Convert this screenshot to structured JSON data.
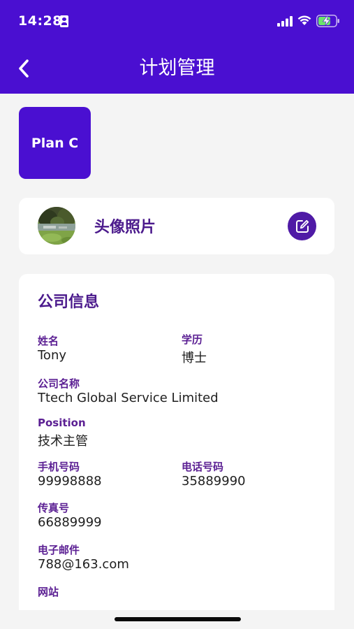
{
  "status_bar": {
    "time": "14:28",
    "icons": [
      "id-card-icon",
      "cellular-signal-icon",
      "wifi-icon",
      "battery-charging-icon"
    ]
  },
  "header": {
    "title": "计划管理",
    "back_icon": "chevron-left-icon",
    "background_color": "#4a0fd1"
  },
  "plan": {
    "label": "Plan C"
  },
  "avatar_section": {
    "label": "头像照片",
    "edit_icon": "edit-icon"
  },
  "company_info": {
    "title": "公司信息",
    "fields": {
      "name": {
        "label": "姓名",
        "value": "Tony"
      },
      "education": {
        "label": "学历",
        "value": "博士"
      },
      "company_name": {
        "label": "公司名称",
        "value": "Ttech Global Service Limited"
      },
      "position": {
        "label": "Position",
        "value": "技术主管"
      },
      "mobile": {
        "label": "手机号码",
        "value": "99998888"
      },
      "phone": {
        "label": "电话号码",
        "value": "35889990"
      },
      "fax": {
        "label": "传真号",
        "value": "66889999"
      },
      "email": {
        "label": "电子邮件",
        "value": "788@163.com"
      },
      "website": {
        "label": "网站",
        "value": ""
      }
    }
  },
  "colors": {
    "accent": "#4a0fd1",
    "label_purple": "#5b1f93",
    "background": "#f4f4f4"
  }
}
